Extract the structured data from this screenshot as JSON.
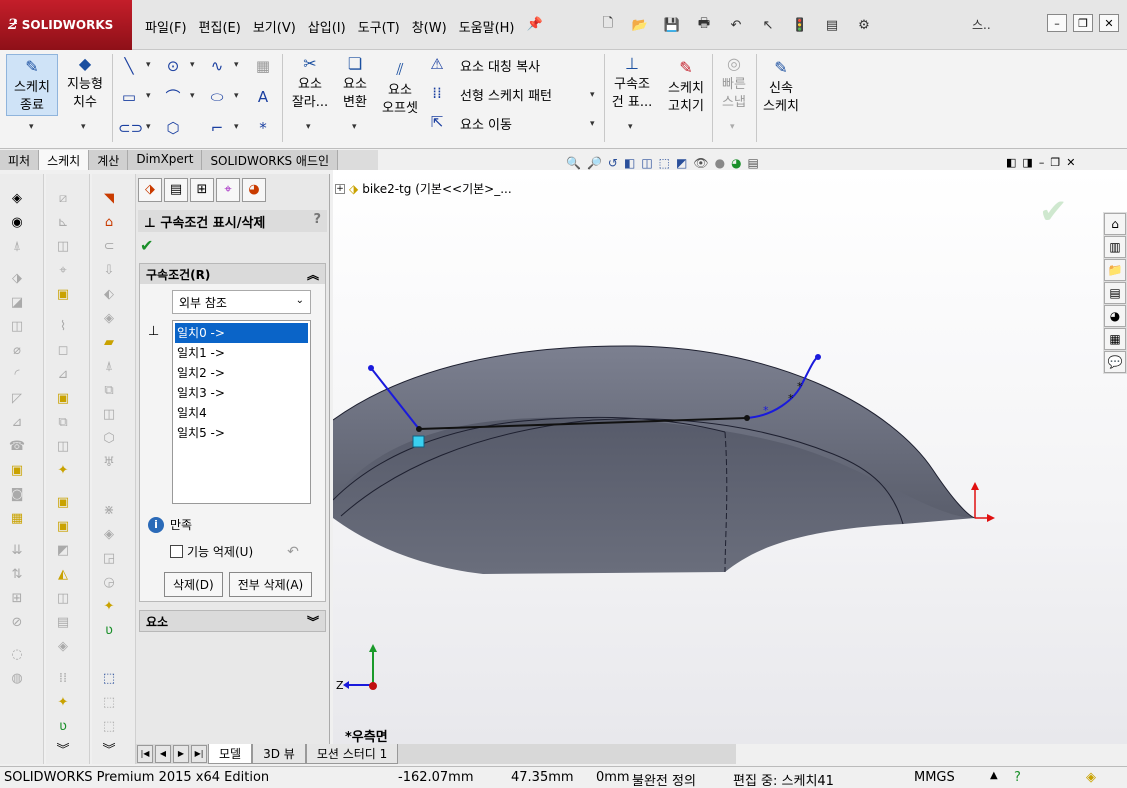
{
  "app": {
    "brand": "SOLIDWORKS"
  },
  "menu": [
    "파일(F)",
    "편집(E)",
    "보기(V)",
    "삽입(I)",
    "도구(T)",
    "창(W)",
    "도움말(H)"
  ],
  "search": {
    "text": "스.."
  },
  "ribbon": {
    "exit_sketch": "스케치\n종료",
    "smart_dim": "지능형\n치수",
    "trim": "요소\n잘라...",
    "convert": "요소\n변환",
    "offset": "요소\n오프셋",
    "mirror": "요소 대칭 복사",
    "pattern": "선형 스케치 패턴",
    "move": "요소 이동",
    "relations": "구속조\n건 표...",
    "repair": "스케치\n고치기",
    "quick_snap": "빠른\n스냅",
    "rapid_sketch": "신속\n스케치"
  },
  "cm_tabs": [
    "피처",
    "스케치",
    "계산",
    "DimXpert",
    "SOLIDWORKS 애드인"
  ],
  "property_manager": {
    "title": "구속조건 표시/삭제",
    "help": "?",
    "group_relations": {
      "title": "구속조건(R)",
      "filter": "외부 참조",
      "items": [
        "일치0 ->",
        "일치1 ->",
        "일치2 ->",
        "일치3 ->",
        "일치4",
        "일치5 ->"
      ],
      "status": "만족",
      "suppress": "기능 억제(U)",
      "delete": "삭제(D)",
      "delete_all": "전부 삭제(A)"
    },
    "group_entities": {
      "title": "요소"
    }
  },
  "viewport": {
    "tree_label": "bike2-tg  (기본<<기본>_...",
    "view_name": "*우측면",
    "triad_z": "Z"
  },
  "bottom_tabs": [
    "모델",
    "3D 뷰",
    "모션 스터디 1"
  ],
  "statusbar": {
    "edition": "SOLIDWORKS Premium 2015 x64 Edition",
    "x": "-162.07mm",
    "y": "47.35mm",
    "z": "0mm",
    "definition": "불완전 정의",
    "editing": "편집 중: 스케치41",
    "units": "MMGS"
  },
  "colors": {
    "accent": "#c41e2a",
    "selection": "#0a64c8",
    "sketch_line": "#1a1adc",
    "surface": "#5e6270"
  }
}
